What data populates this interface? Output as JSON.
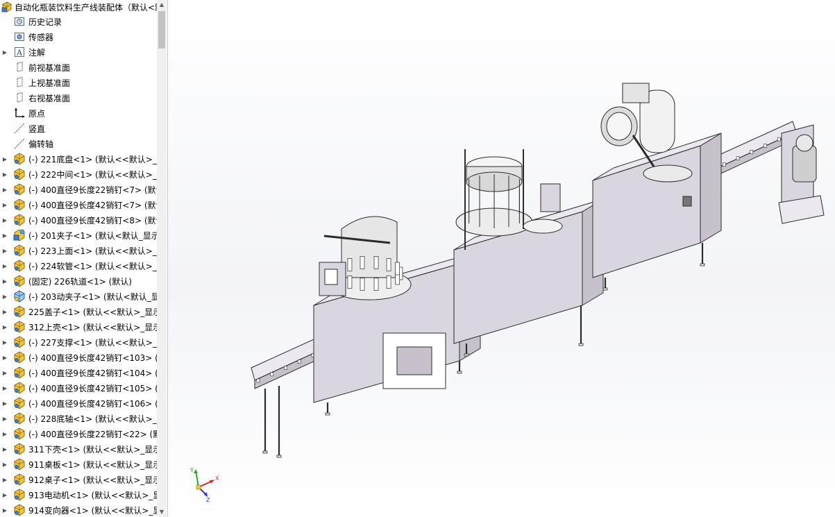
{
  "tree": {
    "root": {
      "label": "自动化瓶装饮料生产线装配体（默认<默"
    },
    "items": [
      {
        "label": "历史记录",
        "icon": "history-icon",
        "expandable": false
      },
      {
        "label": "传感器",
        "icon": "sensor-icon",
        "expandable": false
      },
      {
        "label": "注解",
        "icon": "annotation-icon",
        "expandable": true
      },
      {
        "label": "前视基准面",
        "icon": "plane-icon",
        "expandable": false
      },
      {
        "label": "上视基准面",
        "icon": "plane-icon",
        "expandable": false
      },
      {
        "label": "右视基准面",
        "icon": "plane-icon",
        "expandable": false
      },
      {
        "label": "原点",
        "icon": "origin-icon",
        "expandable": false
      },
      {
        "label": "竖直",
        "icon": "axis-icon",
        "expandable": false
      },
      {
        "label": "偏转轴",
        "icon": "axis-icon",
        "expandable": false
      },
      {
        "label": "(-) 221底盘<1> (默认<<默认>_显",
        "icon": "part-icon",
        "expandable": true
      },
      {
        "label": "(-) 222中间<1> (默认<<默认>_显",
        "icon": "part-icon",
        "expandable": true
      },
      {
        "label": "(-) 400直径9长度22销钉<7> (默认",
        "icon": "part-icon",
        "expandable": true
      },
      {
        "label": "(-) 400直径9长度42销钉<7> (默认",
        "icon": "part-icon",
        "expandable": true
      },
      {
        "label": "(-) 400直径9长度42销钉<8> (默认",
        "icon": "part-icon",
        "expandable": true
      },
      {
        "label": "(-) 201夹子<1> (默认<默认_显示",
        "icon": "subassembly-icon",
        "expandable": true
      },
      {
        "label": "(-) 223上面<1> (默认<<默认>_显",
        "icon": "part-icon",
        "expandable": true
      },
      {
        "label": "(-) 224软管<1> (默认<<默认>_显",
        "icon": "part-icon",
        "expandable": true
      },
      {
        "label": "(固定) 226轨道<1> (默认)",
        "icon": "part-icon",
        "expandable": true
      },
      {
        "label": "(-) 203动夹子<1> (默认<默认_显",
        "icon": "assembly-icon",
        "expandable": true
      },
      {
        "label": "225盖子<1> (默认<<默认>_显示",
        "icon": "part-icon",
        "expandable": true
      },
      {
        "label": "312上壳<1> (默认<<默认>_显示",
        "icon": "part-icon",
        "expandable": true
      },
      {
        "label": "(-) 227支撑<1> (默认<<默认>_显",
        "icon": "part-icon",
        "expandable": true
      },
      {
        "label": "(-) 400直径9长度42销钉<103> (默",
        "icon": "part-icon",
        "expandable": true
      },
      {
        "label": "(-) 400直径9长度42销钉<104> (默",
        "icon": "part-icon",
        "expandable": true
      },
      {
        "label": "(-) 400直径9长度42销钉<105> (默",
        "icon": "part-icon",
        "expandable": true
      },
      {
        "label": "(-) 400直径9长度42销钉<106> (默",
        "icon": "part-icon",
        "expandable": true
      },
      {
        "label": "(-) 228底轴<1> (默认<<默认>_显",
        "icon": "part-icon",
        "expandable": true
      },
      {
        "label": "(-) 400直径9长度22销钉<22> (默认",
        "icon": "part-icon",
        "expandable": true
      },
      {
        "label": "311下壳<1> (默认<<默认>_显示",
        "icon": "part-icon",
        "expandable": true
      },
      {
        "label": "911桌板<1> (默认<<默认>_显示",
        "icon": "part-icon",
        "expandable": true
      },
      {
        "label": "912桌子<1> (默认<<默认>_显示",
        "icon": "part-icon",
        "expandable": true
      },
      {
        "label": "913电动机<1> (默认<<默认>_显",
        "icon": "part-icon",
        "expandable": true
      },
      {
        "label": "914变向器<1> (默认<<默认>_显",
        "icon": "part-icon",
        "expandable": true
      }
    ]
  },
  "triad": {
    "x": "X",
    "y": "Y",
    "z": "Z"
  },
  "colors": {
    "machine_fill": "#dad6df",
    "machine_side": "#c7c1cc",
    "machine_top": "#ebe8ef",
    "outline": "#2b2b2b",
    "part_yellow": "#f6c53b",
    "axis_x": "#d62a2a",
    "axis_y": "#2aa82a",
    "axis_z": "#2a3ad6"
  }
}
